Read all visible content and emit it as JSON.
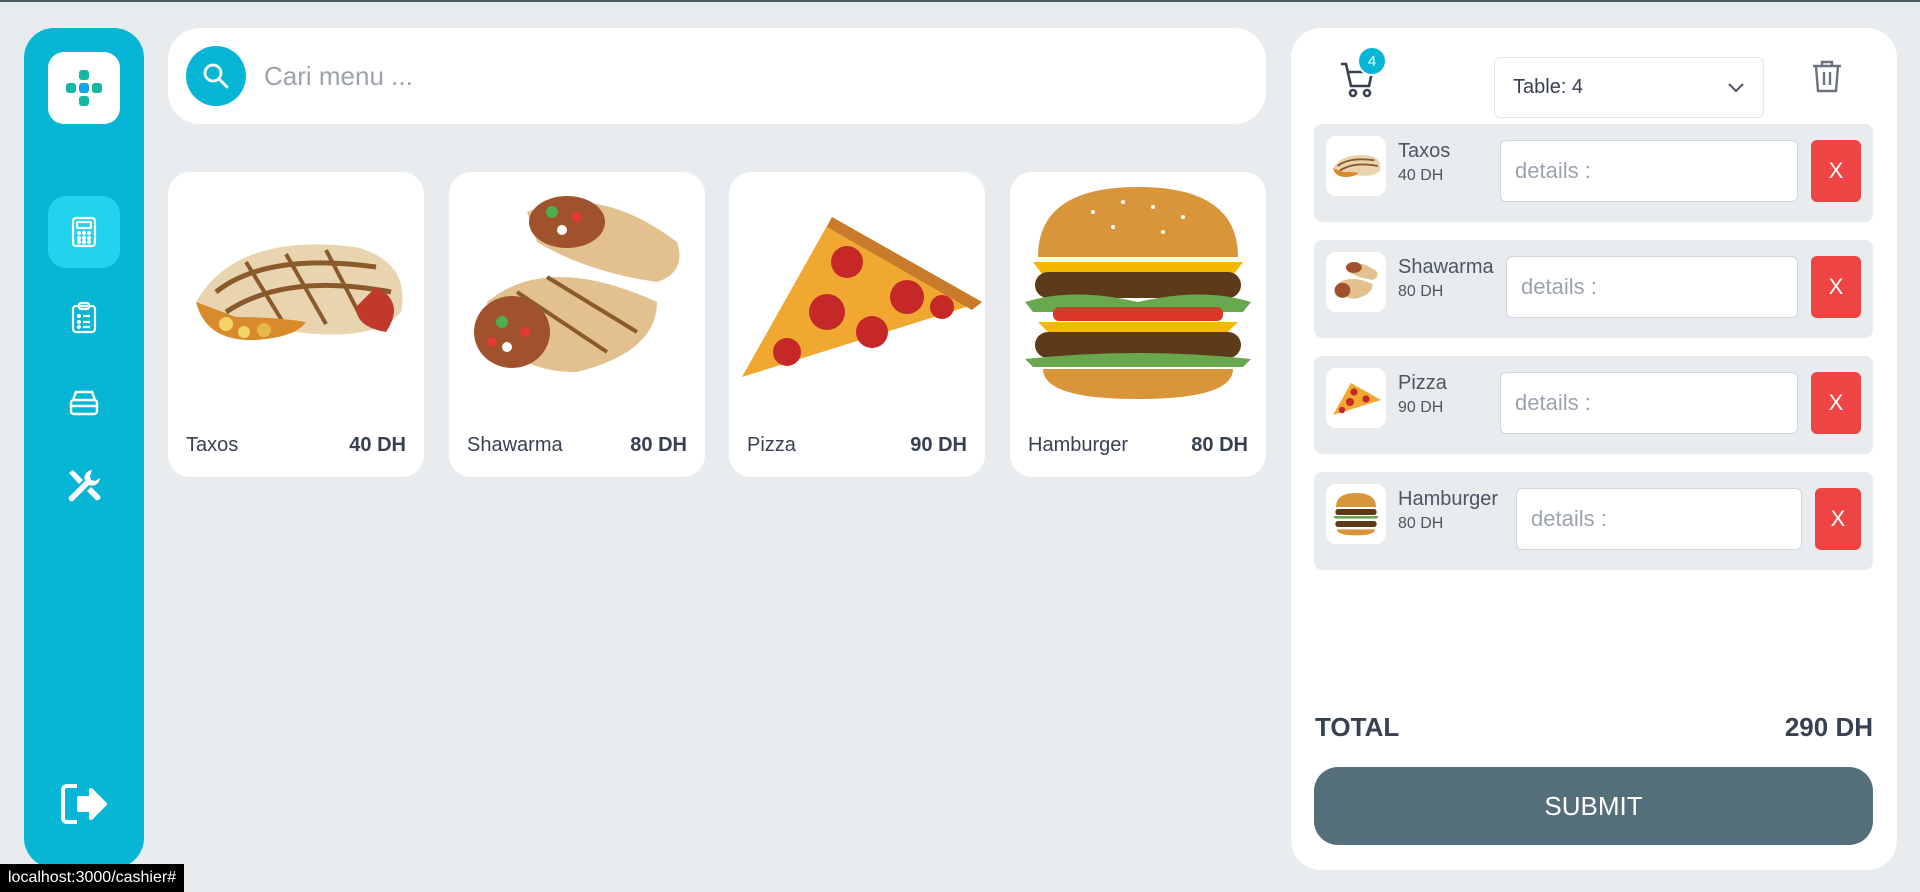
{
  "search": {
    "placeholder": "Cari menu ..."
  },
  "sidebar": {
    "items": [
      {
        "icon": "calculator-icon",
        "active": true
      },
      {
        "icon": "clipboard-list-icon",
        "active": false
      },
      {
        "icon": "tray-stack-icon",
        "active": false
      },
      {
        "icon": "tools-icon",
        "active": false
      }
    ],
    "logout_icon": "logout-icon"
  },
  "menu": [
    {
      "name": "Taxos",
      "price": "40 DH"
    },
    {
      "name": "Shawarma",
      "price": "80 DH"
    },
    {
      "name": "Pizza",
      "price": "90 DH"
    },
    {
      "name": "Hamburger",
      "price": "80 DH"
    }
  ],
  "order": {
    "cart_count": "4",
    "table": "Table: 4",
    "items": [
      {
        "name": "Taxos",
        "price": "40 DH",
        "placeholder": "details :",
        "remove": "X"
      },
      {
        "name": "Shawarma",
        "price": "80 DH",
        "placeholder": "details :",
        "remove": "X"
      },
      {
        "name": "Pizza",
        "price": "90 DH",
        "placeholder": "details :",
        "remove": "X"
      },
      {
        "name": "Hamburger",
        "price": "80 DH",
        "placeholder": "details :",
        "remove": "X"
      }
    ],
    "total_label": "TOTAL",
    "total_value": "290 DH",
    "submit_label": "SUBMIT"
  },
  "status_url": "localhost:3000/cashier#",
  "colors": {
    "accent": "#06b6d4",
    "danger": "#ef4444",
    "submit": "#546e7a",
    "background": "#e8ecef"
  }
}
